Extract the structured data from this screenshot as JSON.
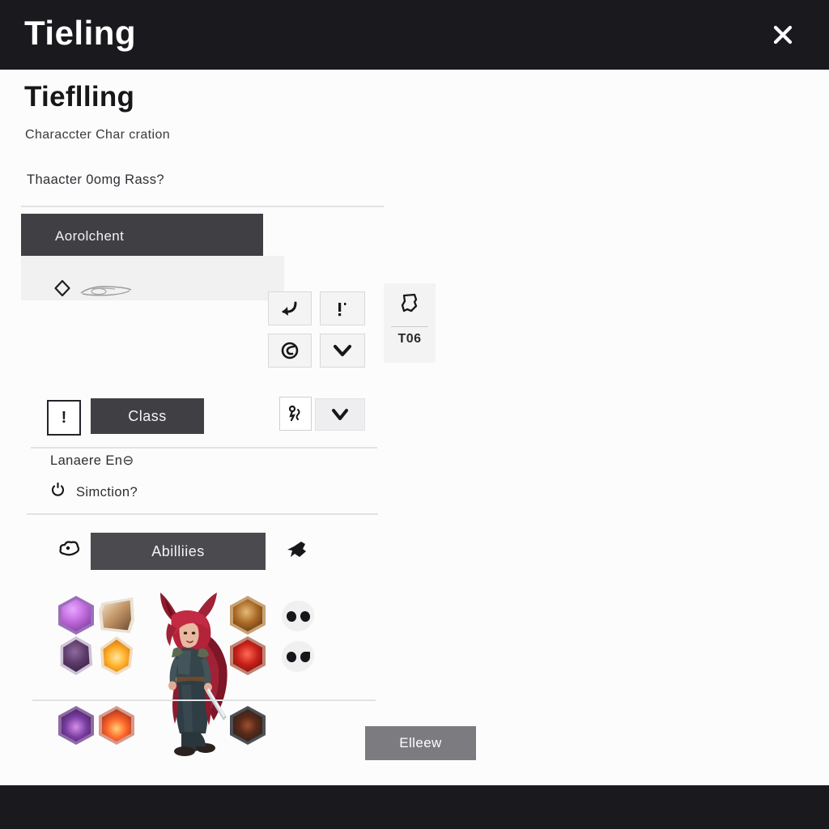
{
  "window": {
    "title": "Tieling",
    "close_icon": "close-x-icon"
  },
  "page": {
    "heading": "Tieflling",
    "subtitle": "Characcter Char cration",
    "question": "Thaacter 0omg Rass?"
  },
  "rows": {
    "alignment": {
      "label": "Aorolchent",
      "diamond_icon": "diamond-outline-icon",
      "sketch_icon": "sketch-line-icon",
      "buttons": [
        {
          "icon": "arrow-hook-icon",
          "glyph": "↵"
        },
        {
          "icon": "exclamation-icon",
          "glyph": "!·"
        },
        {
          "icon": "spiral-swirl-icon",
          "glyph": "ʘ"
        },
        {
          "icon": "chevron-down-icon",
          "glyph": "∨"
        }
      ]
    },
    "info_panel": {
      "shield_icon": "shield-outline-icon",
      "code": "T06"
    },
    "class": {
      "bang_label": "!",
      "button_label": "Class",
      "buttons": [
        {
          "icon": "rune-scribble-icon",
          "glyph": "ж"
        },
        {
          "icon": "chevron-down-icon",
          "glyph": "∨"
        }
      ],
      "language_line": "Lanaere En⊖",
      "sim_icon": "power-circle-icon",
      "sim_label": "Simction?"
    },
    "abilities": {
      "puff_icon": "cloud-puff-icon",
      "button_label": "Abilliies",
      "flag_icon": "flag-arrow-icon"
    }
  },
  "icon_grid": {
    "gems": [
      {
        "name": "gem-arcane-violet",
        "col": "left",
        "row": 1,
        "outer": "#9b6fb8",
        "c1": "#c46fe0",
        "c2": "#6d2f8f"
      },
      {
        "name": "gem-scroll-parchment",
        "col": "left2",
        "row": 1,
        "outer": "#e9e2d6",
        "c1": "#b9906a",
        "c2": "#6d4a2e"
      },
      {
        "name": "gem-shadow-plum",
        "col": "left",
        "row": 2,
        "outer": "#cfc3d6",
        "c1": "#6c4b7a",
        "c2": "#38203f"
      },
      {
        "name": "gem-flame-amber",
        "col": "left2",
        "row": 2,
        "outer": "#f0dcc0",
        "c1": "#ffc24a",
        "c2": "#c45a08"
      },
      {
        "name": "gem-void-purple",
        "col": "left",
        "row": 3,
        "outer": "#8e6aa6",
        "c1": "#8e4fb5",
        "c2": "#3a2146"
      },
      {
        "name": "gem-ember-crimson",
        "col": "left2",
        "row": 3,
        "outer": "#d59a8e",
        "c1": "#ff7a3c",
        "c2": "#8c1a18"
      },
      {
        "name": "gem-sigil-bronze",
        "col": "right",
        "row": 1,
        "outer": "#c7a173",
        "c1": "#b4712c",
        "c2": "#5d3210"
      },
      {
        "name": "gem-rune-blood",
        "col": "right",
        "row": 2,
        "outer": "#c08474",
        "c1": "#d22a1e",
        "c2": "#5e0f0c"
      },
      {
        "name": "gem-obsidian-dark",
        "col": "right",
        "row": 3,
        "outer": "#4d5054",
        "c1": "#6a3a2a",
        "c2": "#1d1f22"
      }
    ],
    "badges": [
      {
        "name": "badge-twin-dots",
        "row": 1
      },
      {
        "name": "badge-dot-leaf",
        "row": 2
      }
    ],
    "portrait": {
      "name": "tiefling-character-portrait",
      "hair_color": "#b3233a",
      "horn_color": "#8e1b2c",
      "cloak_color": "#8e1b2c",
      "armor_color": "#36454a",
      "skin_color": "#e8b9a0"
    }
  },
  "footer": {
    "button_label": "Elleew"
  }
}
